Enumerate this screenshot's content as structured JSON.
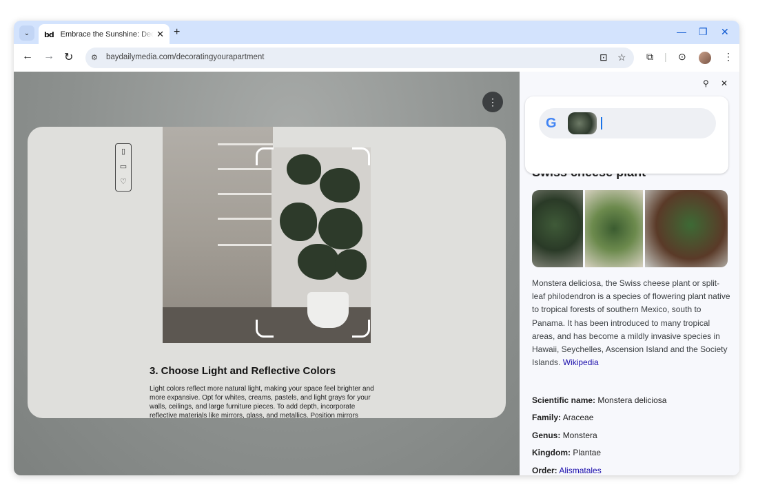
{
  "tab": {
    "title": "Embrace the Sunshine: Decorating Your Apartment",
    "favicon_text": "bd"
  },
  "omnibox": {
    "url": "baydailymedia.com/decoratingyourapartment"
  },
  "article": {
    "heading": "3. Choose Light and Reflective Colors",
    "body": "Light colors reflect more natural light, making your space feel brighter and more expansive. Opt for whites, creams, pastels, and light grays for your walls, ceilings, and large furniture pieces. To add depth, incorporate reflective materials like mirrors, glass, and metallics. Position mirrors"
  },
  "panel": {
    "result_title": "Swiss cheese plant",
    "description": "Monstera deliciosa, the Swiss cheese plant or split-leaf philodendron is a species of flowering plant native to tropical forests of southern Mexico, south to Panama. It has been introduced to many tropical areas, and has become a mildly invasive species in Hawaii, Seychelles, Ascension Island and the Society Islands.",
    "source_link": "Wikipedia",
    "facts": [
      {
        "label": "Scientific name:",
        "value": "Monstera deliciosa"
      },
      {
        "label": "Family:",
        "value": "Araceae"
      },
      {
        "label": "Genus:",
        "value": "Monstera"
      },
      {
        "label": "Kingdom:",
        "value": "Plantae"
      },
      {
        "label": "Order:",
        "value": "Alismatales"
      }
    ]
  },
  "icons": {
    "tab_search": "chevron-down-icon",
    "new_tab": "plus-icon",
    "minimize": "minimize-icon",
    "restore": "restore-icon",
    "close": "close-icon",
    "back": "arrow-left-icon",
    "forward": "arrow-right-icon",
    "reload": "reload-icon",
    "site_info": "tune-icon",
    "lens": "lens-icon",
    "bookmark": "star-icon",
    "extensions": "puzzle-icon",
    "menu": "kebab-icon",
    "pin": "pin-icon",
    "google": "google-g-icon"
  },
  "colors": {
    "tabstrip": "#d3e3fd",
    "omnibox": "#e9eef6",
    "link": "#1a0dab",
    "accent": "#0b57d0"
  }
}
